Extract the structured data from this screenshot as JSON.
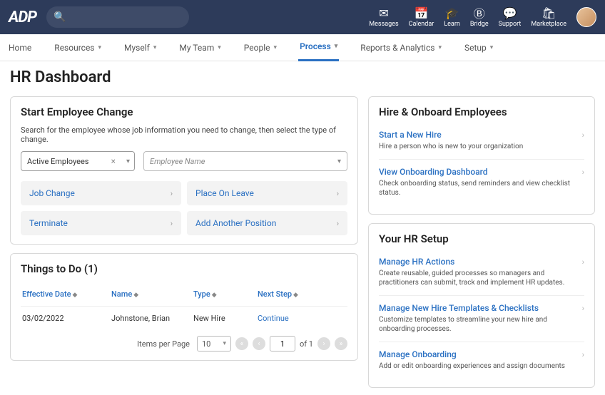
{
  "app": {
    "logo": "ADP"
  },
  "topnav": {
    "items": [
      {
        "label": "Messages",
        "icon": "✉"
      },
      {
        "label": "Calendar",
        "icon": "📅"
      },
      {
        "label": "Learn",
        "icon": "🎓"
      },
      {
        "label": "Bridge",
        "icon": "Ⓑ"
      },
      {
        "label": "Support",
        "icon": "💬"
      },
      {
        "label": "Marketplace",
        "icon": "🛍"
      }
    ]
  },
  "nav": {
    "items": [
      {
        "label": "Home",
        "dd": false
      },
      {
        "label": "Resources",
        "dd": true
      },
      {
        "label": "Myself",
        "dd": true
      },
      {
        "label": "My Team",
        "dd": true
      },
      {
        "label": "People",
        "dd": true
      },
      {
        "label": "Process",
        "dd": true,
        "active": true
      },
      {
        "label": "Reports & Analytics",
        "dd": true
      },
      {
        "label": "Setup",
        "dd": true
      }
    ]
  },
  "page": {
    "title": "HR Dashboard"
  },
  "start_change": {
    "title": "Start Employee Change",
    "help": "Search for the employee whose job information you need to change, then select the type of change.",
    "filter_value": "Active Employees",
    "name_placeholder": "Employee Name",
    "actions": [
      {
        "label": "Job Change"
      },
      {
        "label": "Place On Leave"
      },
      {
        "label": "Terminate"
      },
      {
        "label": "Add Another Position"
      }
    ]
  },
  "todo": {
    "title": "Things to Do (1)",
    "cols": [
      "Effective Date",
      "Name",
      "Type",
      "Next Step"
    ],
    "rows": [
      {
        "date": "03/02/2022",
        "name": "Johnstone, Brian",
        "type": "New Hire",
        "next": "Continue"
      }
    ],
    "pager": {
      "label": "Items per Page",
      "size": "10",
      "page": "1",
      "of_label": "of 1"
    }
  },
  "hire": {
    "title": "Hire & Onboard Employees",
    "links": [
      {
        "label": "Start a New Hire",
        "desc": "Hire a person who is new to your organization"
      },
      {
        "label": "View Onboarding Dashboard",
        "desc": "Check onboarding status, send reminders and view checklist status."
      }
    ]
  },
  "setup": {
    "title": "Your HR Setup",
    "links": [
      {
        "label": "Manage HR Actions",
        "desc": "Create reusable, guided processes so managers and practitioners can submit, track and implement HR updates."
      },
      {
        "label": "Manage New Hire Templates & Checklists",
        "desc": "Customize templates to streamline your new hire and onboarding processes."
      },
      {
        "label": "Manage Onboarding",
        "desc": "Add or edit onboarding experiences and assign documents"
      }
    ]
  }
}
